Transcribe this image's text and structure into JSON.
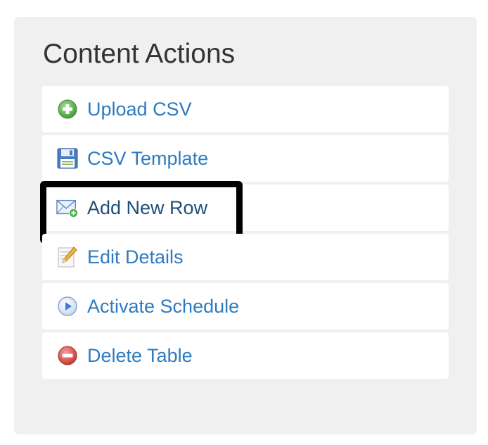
{
  "panel": {
    "title": "Content Actions",
    "actions": [
      {
        "label": "Upload CSV",
        "icon": "plus-circle-icon",
        "color": "#4cae4c"
      },
      {
        "label": "CSV Template",
        "icon": "floppy-disk-icon",
        "color": "#3b6fb6"
      },
      {
        "label": "Add New Row",
        "icon": "envelope-add-icon",
        "color": "#4cae4c",
        "highlighted": true
      },
      {
        "label": "Edit Details",
        "icon": "pencil-icon",
        "color": "#e8a33c"
      },
      {
        "label": "Activate Schedule",
        "icon": "play-circle-icon",
        "color": "#3b7ed6"
      },
      {
        "label": "Delete Table",
        "icon": "minus-circle-icon",
        "color": "#d9534f"
      }
    ]
  }
}
